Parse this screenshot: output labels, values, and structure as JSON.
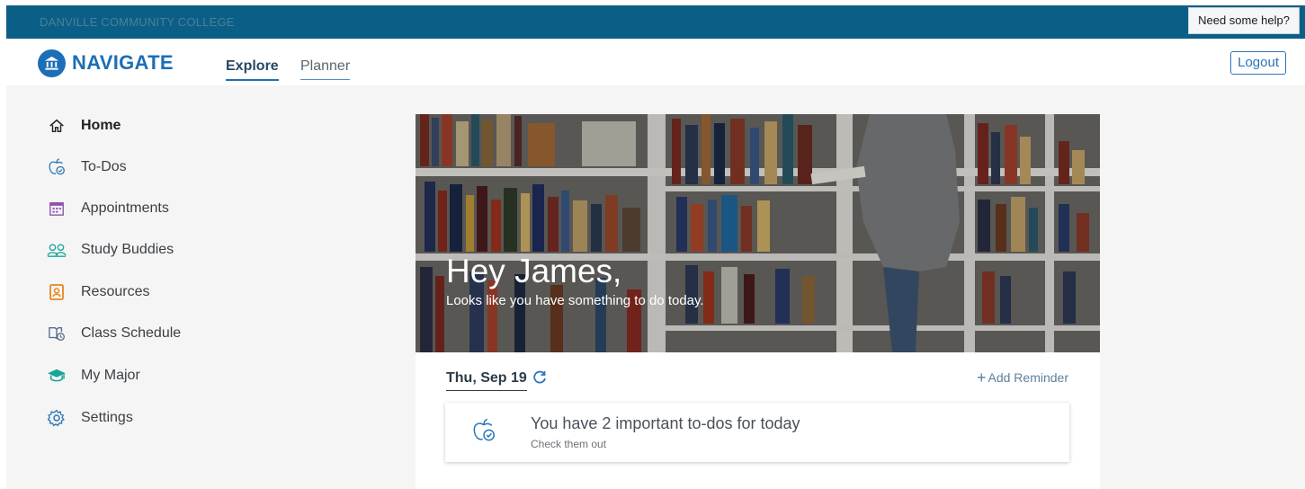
{
  "topbar": {
    "college": "DANVILLE COMMUNITY COLLEGE",
    "help_button": "Need some help?"
  },
  "navbar": {
    "logo_text": "NAVIGATE",
    "tabs": [
      {
        "label": "Explore"
      },
      {
        "label": "Planner"
      }
    ],
    "logout": "Logout"
  },
  "sidebar": {
    "items": [
      {
        "label": "Home",
        "icon": "home-icon"
      },
      {
        "label": "To-Dos",
        "icon": "apple-check-icon"
      },
      {
        "label": "Appointments",
        "icon": "calendar-icon"
      },
      {
        "label": "Study Buddies",
        "icon": "people-icon"
      },
      {
        "label": "Resources",
        "icon": "contact-card-icon"
      },
      {
        "label": "Class Schedule",
        "icon": "book-clock-icon"
      },
      {
        "label": "My Major",
        "icon": "graduation-cap-icon"
      },
      {
        "label": "Settings",
        "icon": "gear-icon"
      }
    ]
  },
  "hero": {
    "greeting": "Hey James,",
    "subtitle": "Looks like you have something to do today."
  },
  "agenda": {
    "date": "Thu, Sep 19",
    "add_reminder": "Add Reminder",
    "card_title": "You have 2 important to-dos for today",
    "card_subtitle": "Check them out"
  },
  "colors": {
    "brand_blue": "#1c6fb7",
    "topbar": "#0b5f86"
  }
}
